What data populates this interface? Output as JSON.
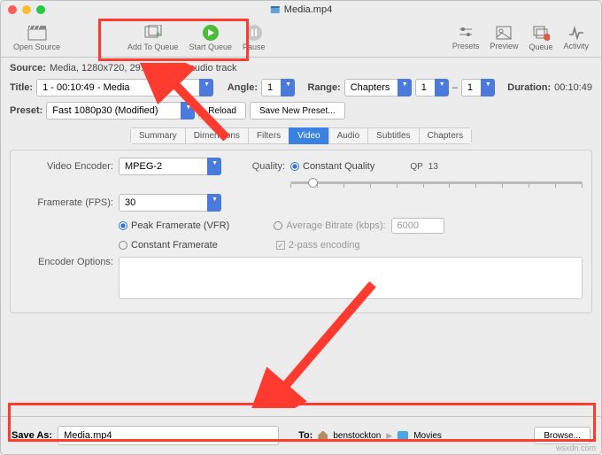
{
  "titlebar": {
    "filename": "Media.mp4"
  },
  "toolbar": {
    "open_source": "Open Source",
    "add_to_queue": "Add To Queue",
    "start_queue": "Start Queue",
    "pause": "Pause",
    "presets": "Presets",
    "preview": "Preview",
    "queue": "Queue",
    "activity": "Activity"
  },
  "source": {
    "label": "Source:",
    "value": "Media, 1280x720, 29.97 FPS, 1 audio track"
  },
  "title_row": {
    "label": "Title:",
    "value": "1 - 00:10:49 - Media",
    "angle_label": "Angle:",
    "angle_value": "1",
    "range_label": "Range:",
    "range_type": "Chapters",
    "range_from": "1",
    "range_sep": "–",
    "range_to": "1",
    "duration_label": "Duration:",
    "duration_value": "00:10:49"
  },
  "preset_row": {
    "label": "Preset:",
    "value": "Fast 1080p30 (Modified)",
    "reload": "Reload",
    "save_new": "Save New Preset..."
  },
  "tabs": [
    "Summary",
    "Dimensions",
    "Filters",
    "Video",
    "Audio",
    "Subtitles",
    "Chapters"
  ],
  "active_tab": "Video",
  "video": {
    "encoder_label": "Video Encoder:",
    "encoder_value": "MPEG-2",
    "quality_label": "Quality:",
    "cq_label": "Constant Quality",
    "qp_label": "QP",
    "qp_value": "13",
    "fps_label": "Framerate (FPS):",
    "fps_value": "30",
    "pfr_label": "Peak Framerate (VFR)",
    "cfr_label": "Constant Framerate",
    "abr_label": "Average Bitrate (kbps):",
    "abr_value": "6000",
    "twopass_label": "2-pass encoding",
    "enc_opts_label": "Encoder Options:"
  },
  "bottom": {
    "saveas_label": "Save As:",
    "saveas_value": "Media.mp4",
    "to_label": "To:",
    "crumb_user": "benstockton",
    "crumb_folder": "Movies",
    "browse": "Browse..."
  },
  "watermark": "wsxdn.com"
}
